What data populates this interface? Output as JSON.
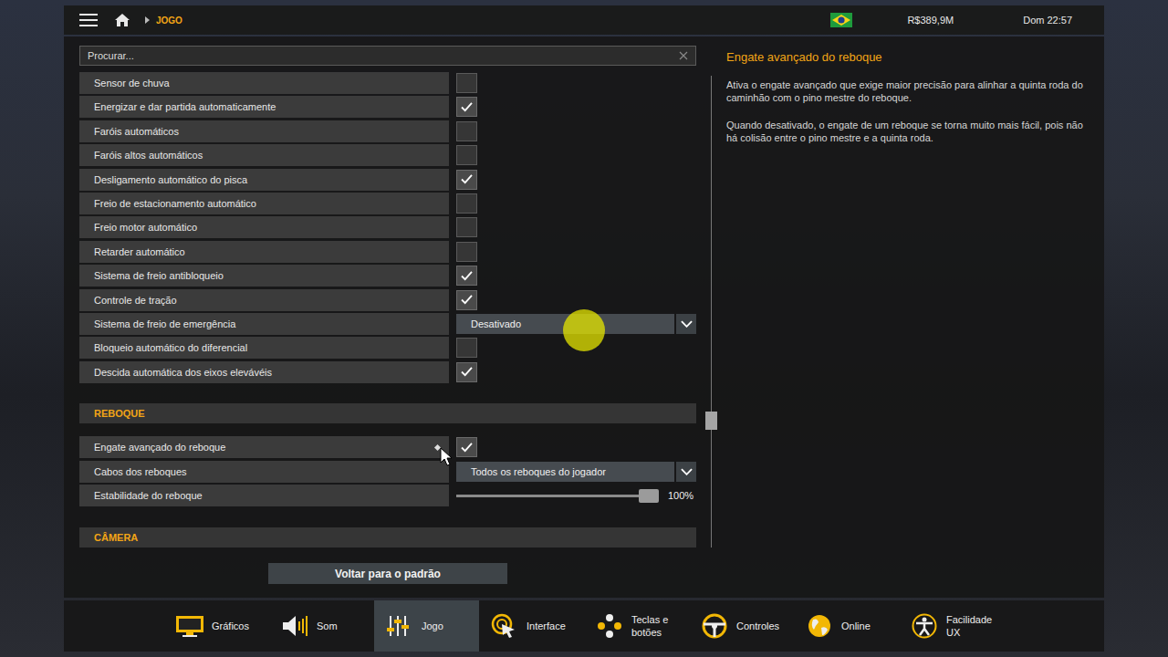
{
  "topbar": {
    "breadcrumb": "JOGO",
    "money": "R$389,9M",
    "clock": "Dom 22:57"
  },
  "search": {
    "placeholder": "Procurar..."
  },
  "settings_rows": [
    {
      "label": "Sensor de chuva",
      "kind": "checkbox",
      "checked": false,
      "modified": false
    },
    {
      "label": "Energizar e dar partida automaticamente",
      "kind": "checkbox",
      "checked": true,
      "modified": false
    },
    {
      "label": "Faróis automáticos",
      "kind": "checkbox",
      "checked": false,
      "modified": false
    },
    {
      "label": "Faróis altos automáticos",
      "kind": "checkbox",
      "checked": false,
      "modified": false
    },
    {
      "label": "Desligamento automático do pisca",
      "kind": "checkbox",
      "checked": true,
      "modified": false
    },
    {
      "label": "Freio de estacionamento automático",
      "kind": "checkbox",
      "checked": false,
      "modified": false
    },
    {
      "label": "Freio motor automático",
      "kind": "checkbox",
      "checked": false,
      "modified": false
    },
    {
      "label": "Retarder automático",
      "kind": "checkbox",
      "checked": false,
      "modified": false
    },
    {
      "label": "Sistema de freio antibloqueio",
      "kind": "checkbox",
      "checked": true,
      "modified": false
    },
    {
      "label": "Controle de tração",
      "kind": "checkbox",
      "checked": true,
      "modified": false
    },
    {
      "label": "Sistema de freio de emergência",
      "kind": "dropdown",
      "value": "Desativado",
      "modified": false
    },
    {
      "label": "Bloqueio automático do diferencial",
      "kind": "checkbox",
      "checked": false,
      "modified": false
    },
    {
      "label": "Descida automática dos eixos elevávéis",
      "kind": "checkbox",
      "checked": true,
      "modified": false
    }
  ],
  "sections": [
    {
      "title": "REBOQUE",
      "rows": [
        {
          "label": "Engate avançado do reboque",
          "kind": "checkbox",
          "checked": true,
          "modified": true
        },
        {
          "label": "Cabos dos reboques",
          "kind": "dropdown",
          "value": "Todos os reboques do jogador",
          "modified": false
        },
        {
          "label": "Estabilidade do reboque",
          "kind": "slider",
          "level": 1.0,
          "reading": "100%",
          "modified": false
        }
      ]
    },
    {
      "title": "CÂMERA",
      "rows": []
    }
  ],
  "scrollbar": {
    "level": 0.74
  },
  "info": {
    "title": "Engate avançado do reboque",
    "paragraphs": [
      "Ativa o engate avançado que exige maior precisão para alinhar a quinta roda do caminhão com o pino mestre do reboque.",
      "Quando desativado, o engate de um reboque se torna muito mais fácil, pois não há colisão entre o pino mestre e a quinta roda."
    ]
  },
  "reset_button": "Voltar para o padrão",
  "nav": [
    {
      "label": "Gráficos",
      "selected": false
    },
    {
      "label": "Som",
      "selected": false
    },
    {
      "label": "Jogo",
      "selected": true
    },
    {
      "label": "Interface",
      "selected": false
    },
    {
      "label": "Teclas e botões",
      "selected": false
    },
    {
      "label": "Controles",
      "selected": false
    },
    {
      "label": "Online",
      "selected": false
    },
    {
      "label": "Facilidade UX",
      "selected": false
    }
  ]
}
